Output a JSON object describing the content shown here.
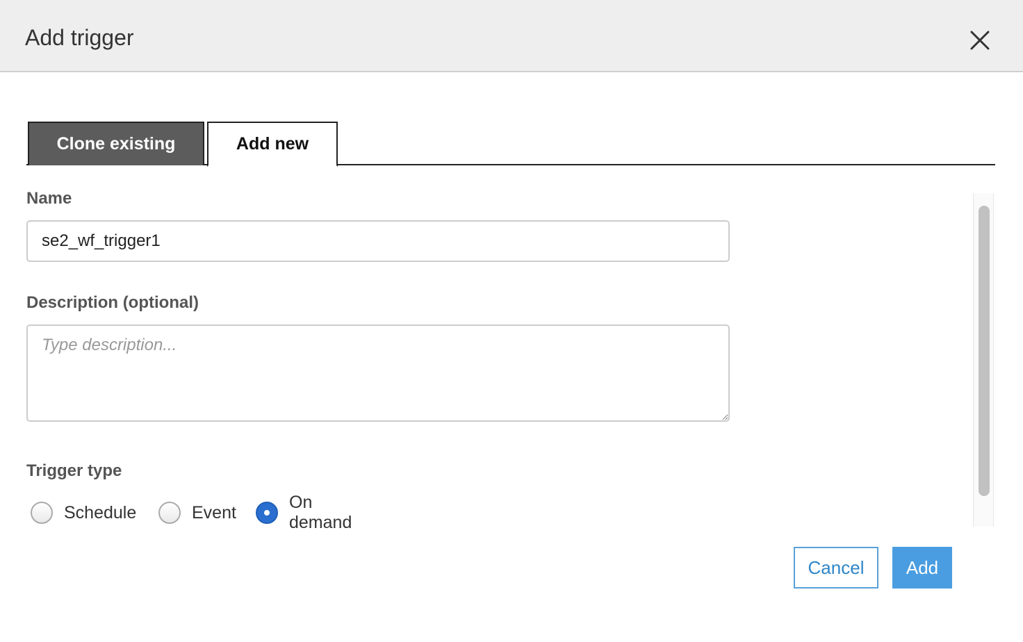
{
  "dialog": {
    "title": "Add trigger",
    "close_icon": "close-icon"
  },
  "tabs": [
    {
      "label": "Clone existing",
      "active": false
    },
    {
      "label": "Add new",
      "active": true
    }
  ],
  "form": {
    "name": {
      "label": "Name",
      "value": "se2_wf_trigger1"
    },
    "description": {
      "label": "Description (optional)",
      "value": "",
      "placeholder": "Type description..."
    },
    "trigger_type": {
      "label": "Trigger type",
      "options": [
        {
          "label": "Schedule",
          "checked": false
        },
        {
          "label": "Event",
          "checked": false
        },
        {
          "label": "On demand",
          "checked": true
        }
      ],
      "selected": "On demand"
    }
  },
  "footer": {
    "cancel_label": "Cancel",
    "add_label": "Add"
  },
  "colors": {
    "header_bg": "#eeeeee",
    "active_tab_bg": "#ffffff",
    "inactive_tab_bg": "#5c5c5c",
    "primary": "#4a9de0",
    "radio_selected": "#2a6fcf"
  }
}
